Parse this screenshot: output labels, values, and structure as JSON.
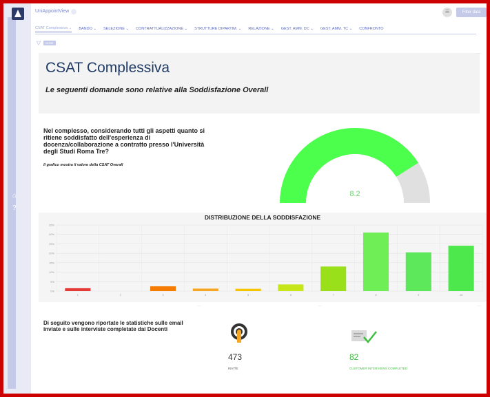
{
  "app": {
    "name": "UniAppointView"
  },
  "toolbar": {
    "primary_label": "Filter data"
  },
  "tabs": [
    {
      "label": "CSAT Complessiva ⌄",
      "active": true
    },
    {
      "label": "BANDO ⌄",
      "active": false
    },
    {
      "label": "SELEZIONE ⌄",
      "active": false
    },
    {
      "label": "CONTRATTUALIZZAZIONE ⌄",
      "active": false
    },
    {
      "label": "STRUTTURE DIPARTIM. ⌄",
      "active": false
    },
    {
      "label": "RELAZIONE ⌄",
      "active": false
    },
    {
      "label": "GEST. AMM. DC ⌄",
      "active": false
    },
    {
      "label": "GEST. AMM. TC ⌄",
      "active": false
    },
    {
      "label": "CONFRONTO",
      "active": false
    }
  ],
  "filters": {
    "chip_label": "NONE"
  },
  "header": {
    "title": "CSAT Complessiva",
    "subtitle": "Le seguenti domande sono relative alla Soddisfazione Overall"
  },
  "overall": {
    "question": "Nel complesso, considerando tutti gli aspetti quanto si ritiene soddisfatto dell'esperienza di docenza/collaborazione a contratto presso l'Università degli Studi Roma Tre?",
    "note": "Il grafico mostra il valore della CSAT Overall",
    "value_label": "8.2",
    "value": 8.2,
    "max": 10,
    "gauge_color": "#4cff4c",
    "track_color": "#e0e0e0",
    "value_color": "#6fd66f"
  },
  "chart_data": {
    "type": "bar",
    "title": "DISTRIBUZIONE DELLA SODDISFAZIONE",
    "categories": [
      "1",
      "2",
      "3",
      "4",
      "5",
      "6",
      "7",
      "8",
      "9",
      "10"
    ],
    "values": [
      1.5,
      0,
      2.5,
      1.3,
      1.2,
      3.5,
      13,
      31,
      20.5,
      24
    ],
    "colors": [
      "#e53935",
      "#e53935",
      "#f57c00",
      "#f5a623",
      "#f5c400",
      "#c6e61a",
      "#99e01a",
      "#6fef55",
      "#5ce85a",
      "#4ce84c"
    ],
    "yticks": [
      "0%",
      "5%",
      "10%",
      "15%",
      "20%",
      "25%",
      "30%",
      "35%"
    ],
    "ylim": [
      0,
      35
    ],
    "grid": true
  },
  "stats": {
    "intro": "Di seguito vengono riportate le statistiche sulle email inviate e sulle interviste completate dai Docenti",
    "invite": {
      "value": "473",
      "label": "INVITE",
      "icon": "target-icon"
    },
    "completed": {
      "value": "82",
      "label": "CUSTOMER INTERVIEWS COMPLETED",
      "icon": "signature-icon",
      "color": "#3fbf3f"
    }
  },
  "rail": {
    "icon_home": "⌂",
    "icon_help": "?"
  }
}
